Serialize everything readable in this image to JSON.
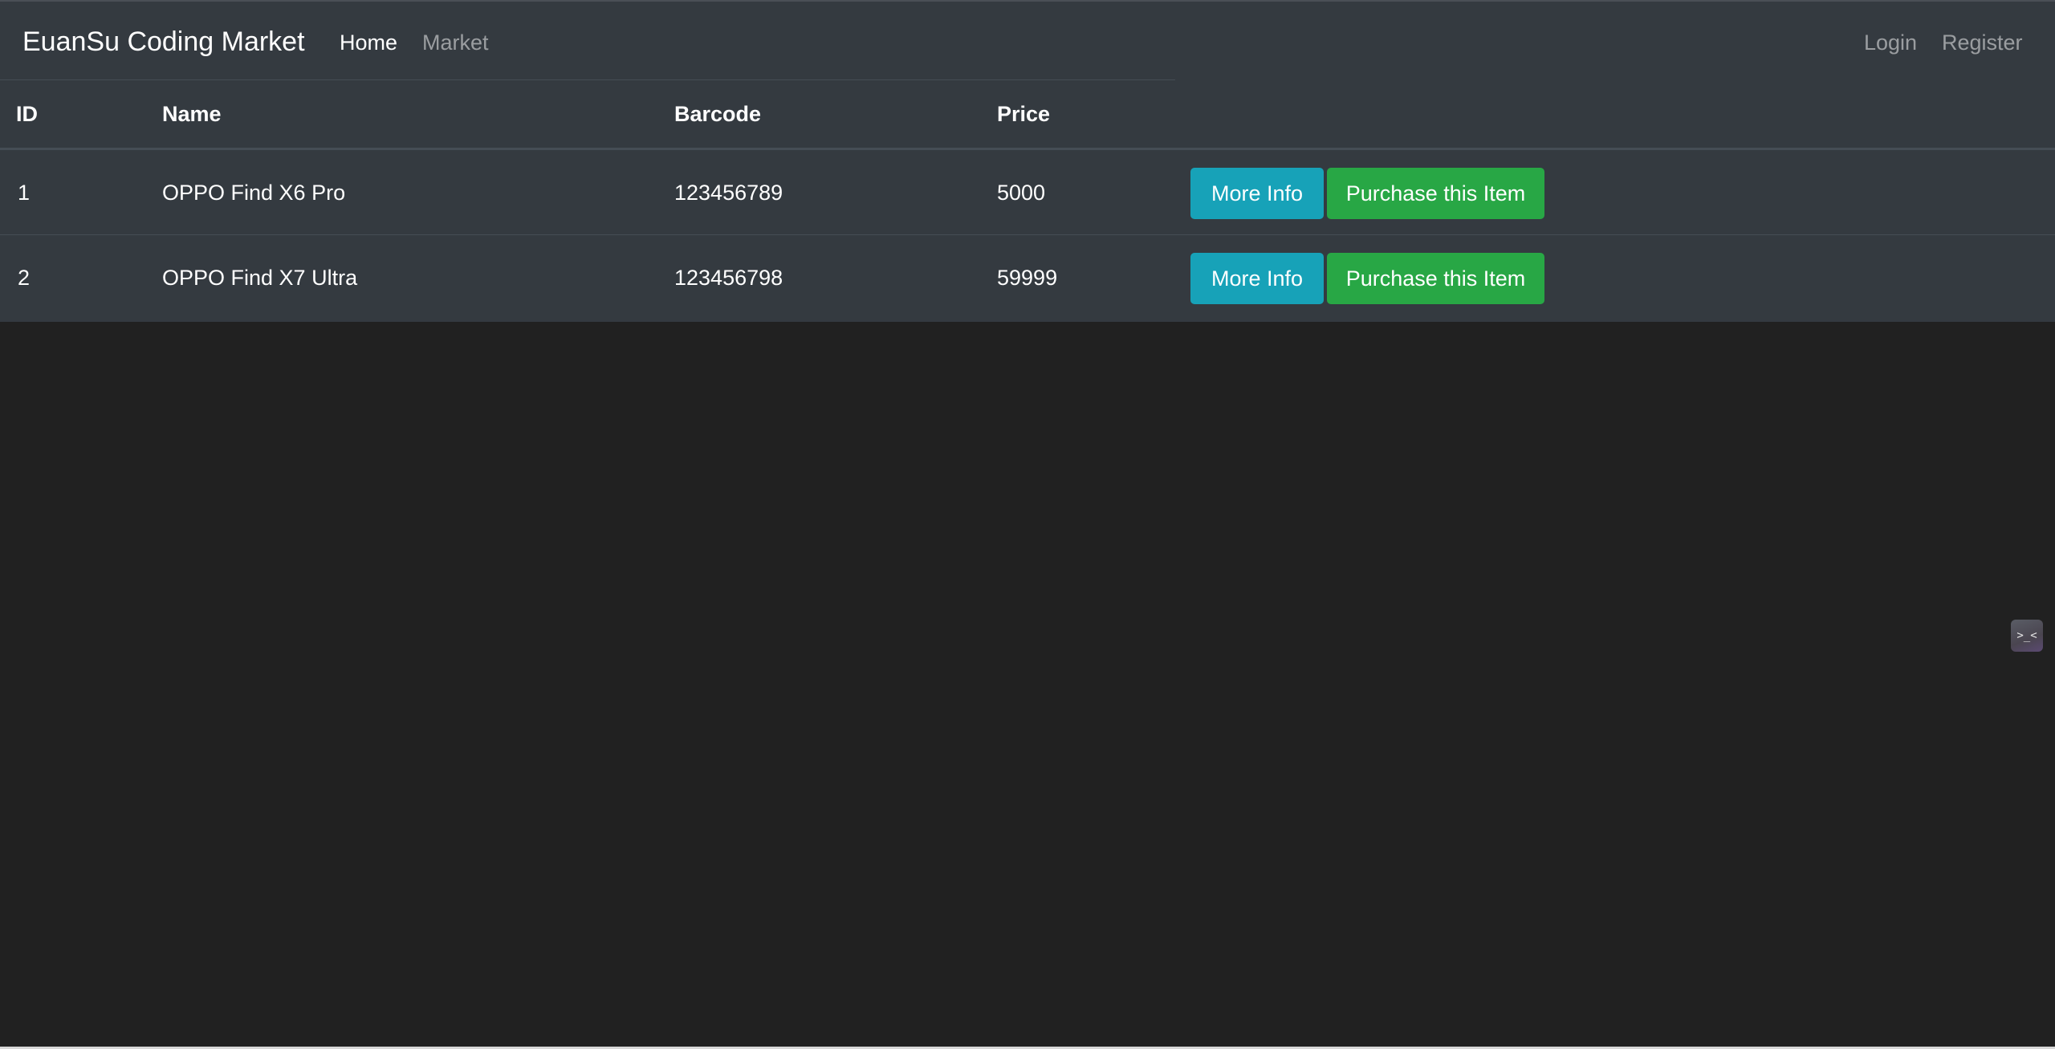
{
  "navbar": {
    "brand": "EuanSu Coding Market",
    "links": {
      "home": "Home",
      "market": "Market"
    },
    "auth": {
      "login": "Login",
      "register": "Register"
    }
  },
  "table": {
    "headers": {
      "id": "ID",
      "name": "Name",
      "barcode": "Barcode",
      "price": "Price"
    },
    "rows": [
      {
        "id": "1",
        "name": "OPPO Find X6 Pro",
        "barcode": "123456789",
        "price": "5000",
        "more_info_label": "More Info",
        "purchase_label": "Purchase this Item"
      },
      {
        "id": "2",
        "name": "OPPO Find X7 Ultra",
        "barcode": "123456798",
        "price": "59999",
        "more_info_label": "More Info",
        "purchase_label": "Purchase this Item"
      }
    ]
  },
  "floating_widget": {
    "icon": "terminal-face-icon",
    "glyph": ">_<"
  },
  "colors": {
    "navbar_bg": "#343a40",
    "page_bg": "#212121",
    "info_button": "#17a2b8",
    "success_button": "#28a745"
  }
}
